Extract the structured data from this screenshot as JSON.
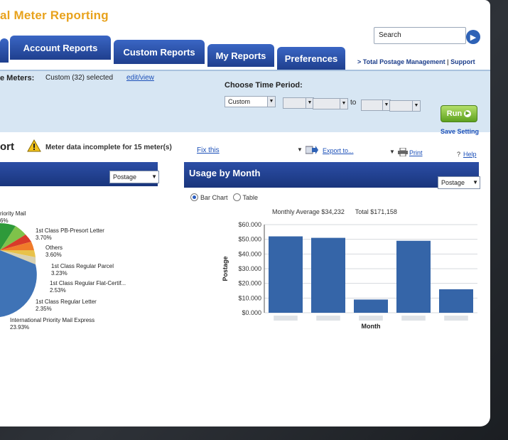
{
  "app": {
    "title": "al Meter Reporting"
  },
  "search": {
    "label": "Search"
  },
  "tabs": [
    {
      "label": "Account Reports"
    },
    {
      "label": "Custom Reports"
    },
    {
      "label": "My Reports"
    },
    {
      "label": "Preferences"
    }
  ],
  "top_links": {
    "total_postage": "> Total Postage Management",
    "separator": "|",
    "support": "Support"
  },
  "filters": {
    "meters_label": "e Meters:",
    "meters_value": "Custom (32) selected",
    "meters_link": "edit/view",
    "time_period_label": "Choose Time Period:",
    "period_value": "Custom",
    "to_label": "to",
    "run_label": "Run",
    "save_setting": "Save Setting"
  },
  "report": {
    "heading": "ort",
    "warning": "Meter data incomplete for 15 meter(s)",
    "fix_link": "Fix this",
    "export_link": "Export to...",
    "print_link": "Print",
    "help_link": "Help"
  },
  "left_panel": {
    "dropdown_value": "Postage",
    "pie_labels": [
      {
        "name": "riority Mail",
        "value": "6%"
      },
      {
        "name": "1st Class PB-Presort Letter",
        "value": "3.70%"
      },
      {
        "name": "Others",
        "value": "3.60%"
      },
      {
        "name": "1st Class Regular Parcel",
        "value": "3.23%"
      },
      {
        "name": "1st Class Regular Flat-Certif...",
        "value": "2.53%"
      },
      {
        "name": "1st Class Regular Letter",
        "value": "2.35%"
      },
      {
        "name": "International Priority Mail Express",
        "value": "23.93%"
      }
    ]
  },
  "usage_panel": {
    "title": "Usage by Month",
    "dropdown_value": "Postage",
    "radio_bar": "Bar Chart",
    "radio_table": "Table",
    "monthly_average": "Monthly Average $34,232",
    "total": "Total $171,158"
  },
  "chart_data": {
    "type": "bar",
    "categories": [
      "",
      "",
      "",
      "",
      ""
    ],
    "values": [
      52000,
      51000,
      9000,
      49000,
      16000
    ],
    "xlabel": "Month",
    "ylabel": "Postage",
    "ylim": [
      0,
      60000
    ],
    "yticks": [
      "$0.000",
      "$10.000",
      "$20.000",
      "$30.000",
      "$40.000",
      "$50.000",
      "$60.000"
    ],
    "bar_color": "#3565a8",
    "grid": true
  },
  "colors": {
    "brand_orange": "#e8a21c",
    "tab_blue": "#2a4ea8",
    "run_green": "#6aae2a",
    "link_blue": "#1b4fb8"
  }
}
